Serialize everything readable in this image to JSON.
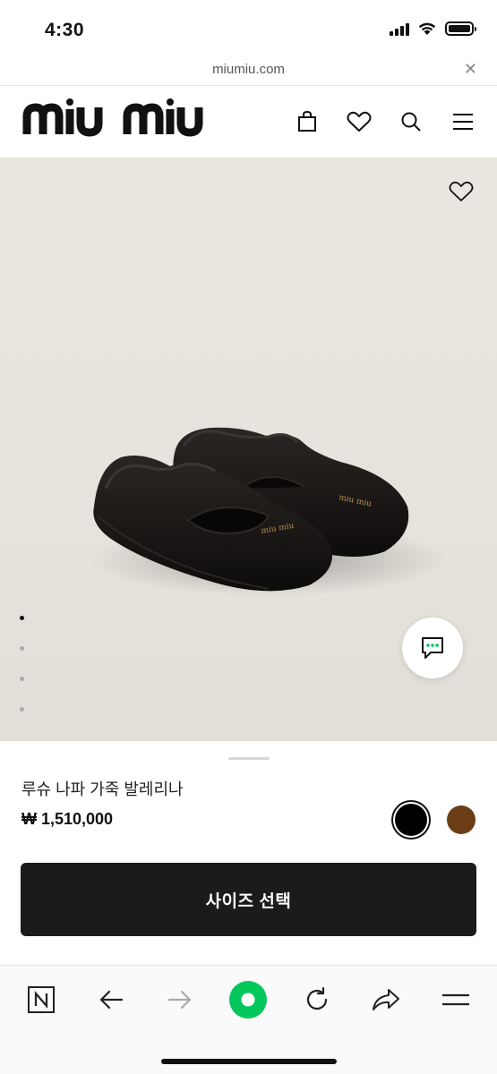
{
  "status_bar": {
    "time": "4:30",
    "icons": [
      "signal-icon",
      "wifi-icon",
      "battery-icon"
    ]
  },
  "browser": {
    "url": "miumiu.com",
    "close_icon": "close-icon",
    "toolbar": [
      "naver-icon",
      "back-icon",
      "forward-icon",
      "green-dot-icon",
      "reload-icon",
      "share-icon",
      "menu-icon"
    ]
  },
  "site": {
    "brand": "miu miu",
    "header_icons": [
      "bag-icon",
      "heart-icon",
      "search-icon",
      "hamburger-icon"
    ]
  },
  "gallery": {
    "image": "black-leather-ballerina-flats",
    "dot_count": 4,
    "active_dot": 0,
    "wishlist_icon": "heart-outline-icon",
    "chat_icon": "chat-bubble-icon"
  },
  "product": {
    "name": "루슈 나파 가죽 발레리나",
    "price": "₩ 1,510,000",
    "colors": [
      {
        "name": "black",
        "hex": "#000000",
        "selected": true
      },
      {
        "name": "brown",
        "hex": "#6b3e16",
        "selected": false
      }
    ],
    "cta_label": "사이즈 선택"
  },
  "colors": {
    "cta_bg": "#1b1b1d",
    "toolbar_accent": "#03c75a"
  }
}
